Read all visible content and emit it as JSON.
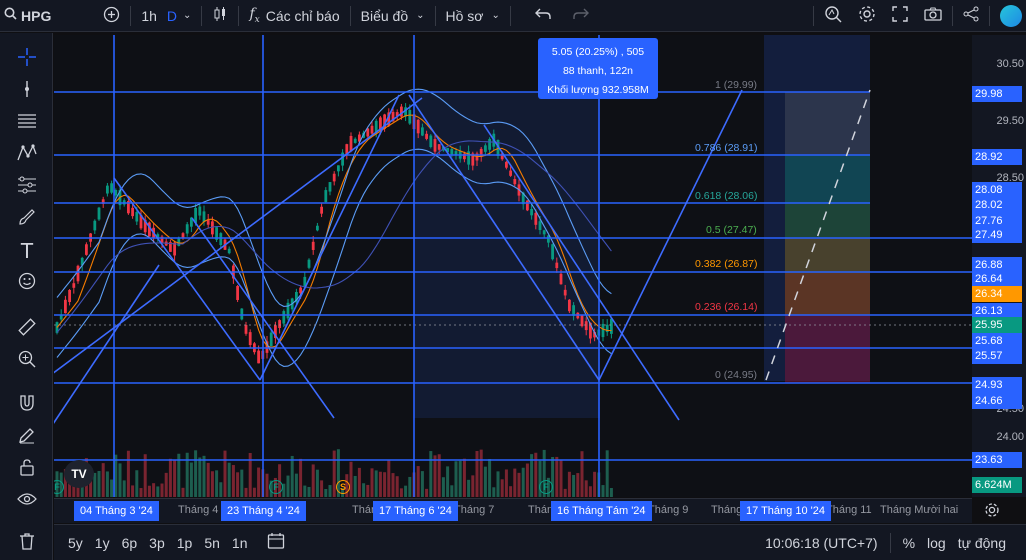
{
  "toolbar": {
    "symbol": "HPG",
    "interval": "1h",
    "interval_unit": "D",
    "indicators_label": "Các chỉ báo",
    "layout_label": "Biểu đồ",
    "profile_label": "Hồ sơ"
  },
  "tooltip": {
    "line1": "5.05 (20.25%) , 505",
    "line2": "88 thanh, 122n",
    "line3": "Khối lượng 932.958M"
  },
  "fib_levels": [
    {
      "label": "1 (29.99)",
      "color": "#787b86"
    },
    {
      "label": "0.786 (28.91)",
      "color": "#5b9cf6"
    },
    {
      "label": "0.618 (28.06)",
      "color": "#26a69a"
    },
    {
      "label": "0.5 (27.47)",
      "color": "#4caf50"
    },
    {
      "label": "0.382 (26.87)",
      "color": "#ff9800"
    },
    {
      "label": "0.236 (26.14)",
      "color": "#f23645"
    },
    {
      "label": "0 (24.95)",
      "color": "#787b86"
    }
  ],
  "price_axis": {
    "plain": [
      "30.50",
      "29.50",
      "28.50",
      "24.50",
      "24.00"
    ],
    "tags": [
      {
        "value": "29.98",
        "color": "#2962ff"
      },
      {
        "value": "28.92",
        "color": "#2962ff"
      },
      {
        "value": "28.08",
        "color": "#2962ff"
      },
      {
        "value": "28.02",
        "color": "#2962ff"
      },
      {
        "value": "27.76",
        "color": "#2962ff"
      },
      {
        "value": "27.49",
        "color": "#2962ff"
      },
      {
        "value": "26.88",
        "color": "#2962ff"
      },
      {
        "value": "26.64",
        "color": "#2962ff"
      },
      {
        "value": "26.34",
        "color": "#ff9800"
      },
      {
        "value": "26.13",
        "color": "#2962ff"
      },
      {
        "value": "25.95",
        "color": "#089981"
      },
      {
        "value": "25.68",
        "color": "#2962ff"
      },
      {
        "value": "25.57",
        "color": "#2962ff"
      },
      {
        "value": "24.93",
        "color": "#2962ff"
      },
      {
        "value": "24.66",
        "color": "#2962ff"
      },
      {
        "value": "23.63",
        "color": "#2962ff"
      },
      {
        "value": "6.624M",
        "color": "#089981"
      }
    ]
  },
  "time_axis": {
    "plain": [
      "Tháng 4",
      "Tháng 7",
      "Tháng 9",
      "Tháng Mười hai",
      "Tháng 11",
      "Tháng"
    ],
    "highlighted": [
      "04 Tháng 3 '24",
      "23 Tháng 4 '24",
      "17 Tháng 6 '24",
      "16 Tháng Tám '24",
      "17 Tháng 10 '24"
    ]
  },
  "bottombar": {
    "ranges": [
      "5y",
      "1y",
      "6p",
      "3p",
      "1p",
      "5n",
      "1n"
    ],
    "clock": "10:06:18 (UTC+7)",
    "percent": "%",
    "log": "log",
    "auto": "tự động"
  },
  "events": [
    "F",
    "F",
    "S",
    "F"
  ],
  "watermark": "TV",
  "colors": {
    "accent": "#2962ff",
    "up": "#089981",
    "down": "#f23645",
    "background": "#0e1015"
  }
}
